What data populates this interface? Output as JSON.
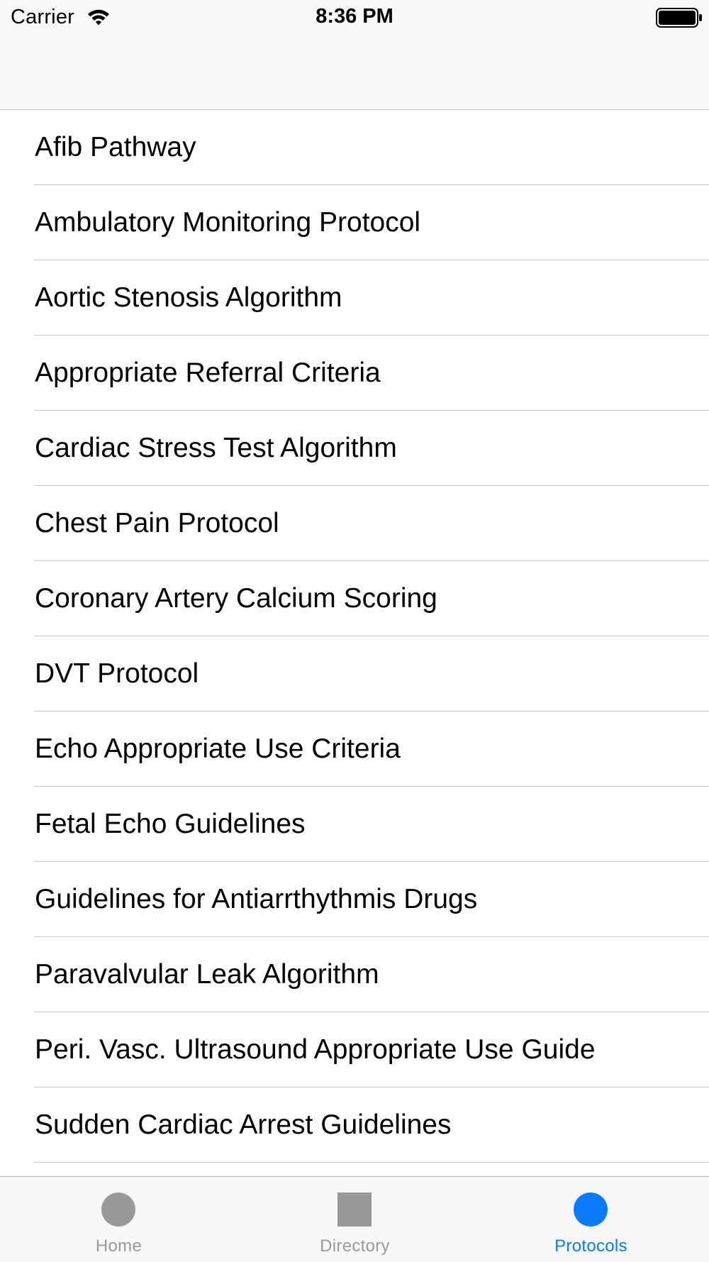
{
  "status_bar": {
    "carrier": "Carrier",
    "time": "8:36 PM",
    "wifi_icon": "wifi-icon",
    "battery_icon": "battery-icon"
  },
  "protocols": [
    "Afib Pathway",
    "Ambulatory Monitoring Protocol",
    "Aortic Stenosis Algorithm",
    "Appropriate Referral Criteria",
    "Cardiac Stress Test Algorithm",
    "Chest Pain Protocol",
    "Coronary Artery Calcium Scoring",
    "DVT Protocol",
    "Echo Appropriate Use Criteria",
    "Fetal Echo Guidelines",
    "Guidelines for Antiarrthythmis Drugs",
    "Paravalvular Leak Algorithm",
    "Peri. Vasc. Ultrasound Appropriate Use Guide",
    "Sudden Cardiac Arrest Guidelines"
  ],
  "tab_bar": {
    "selected": "Protocols",
    "tabs": [
      {
        "label": "Home",
        "icon": "circle-icon"
      },
      {
        "label": "Directory",
        "icon": "square-icon"
      },
      {
        "label": "Protocols",
        "icon": "circle-icon"
      }
    ]
  },
  "colors": {
    "accent": "#0a7aff",
    "inactive": "#999999",
    "separator": "#c8c7cc",
    "bar_background": "#f8f8f8"
  }
}
